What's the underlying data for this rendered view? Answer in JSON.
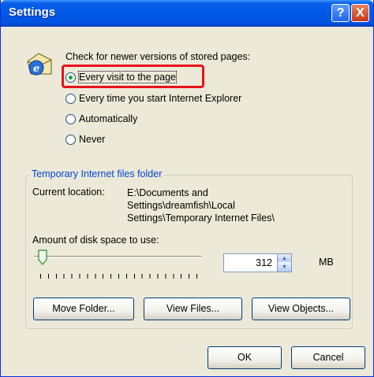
{
  "window": {
    "title": "Settings",
    "help_button": "?",
    "close_button": "X"
  },
  "check": {
    "heading": "Check for newer versions of stored pages:",
    "options": [
      {
        "label": "Every visit to the page",
        "checked": true
      },
      {
        "label": "Every time you start Internet Explorer",
        "checked": false
      },
      {
        "label": "Automatically",
        "checked": false
      },
      {
        "label": "Never",
        "checked": false
      }
    ]
  },
  "temp_folder": {
    "group_label": "Temporary Internet files folder",
    "current_location_label": "Current location:",
    "location_lines": [
      "E:\\Documents and",
      "Settings\\dreamfish\\Local",
      "Settings\\Temporary Internet Files\\"
    ],
    "disk_space_label": "Amount of disk space to use:",
    "disk_space_value": "312",
    "unit": "MB",
    "buttons": {
      "move": "Move Folder...",
      "view_files": "View Files...",
      "view_objects": "View Objects..."
    }
  },
  "dialog_buttons": {
    "ok": "OK",
    "cancel": "Cancel"
  },
  "colors": {
    "titlebar": "#0058e6",
    "background": "#ece9d8",
    "highlight": "#e8101a",
    "group_label": "#0046d5"
  }
}
